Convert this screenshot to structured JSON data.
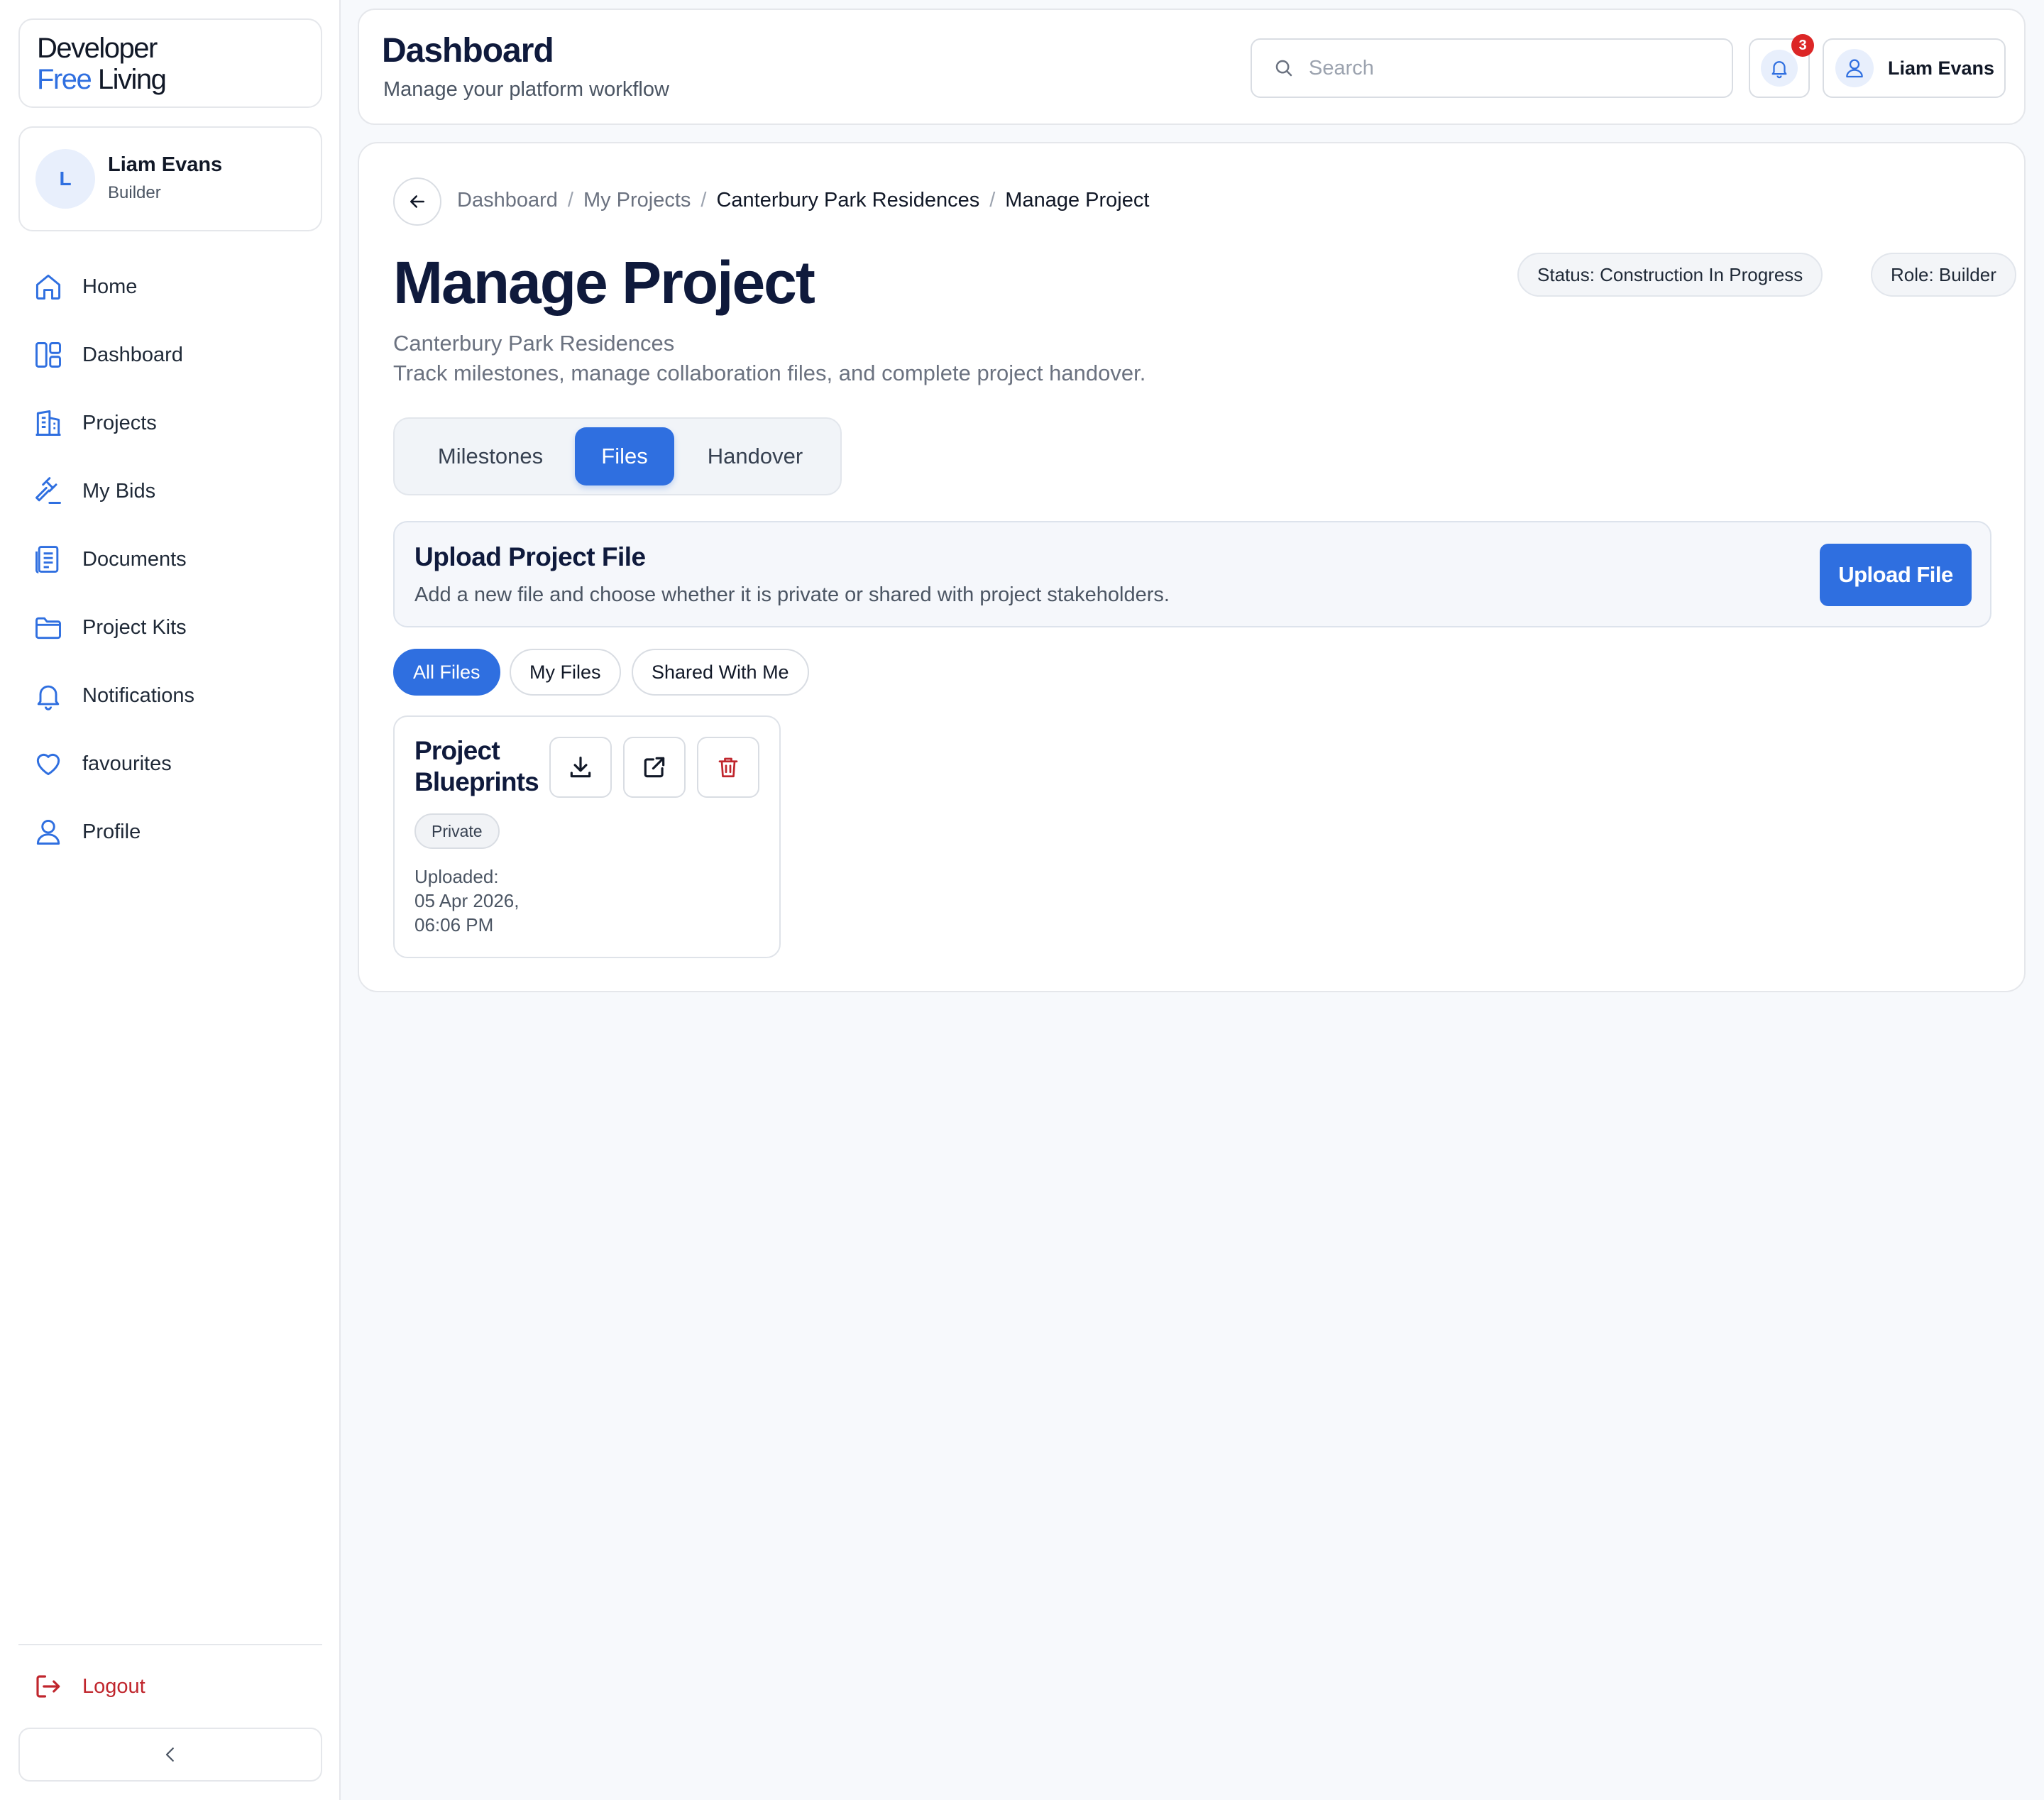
{
  "brand": {
    "line1": "Developer",
    "line2_accent": "Free",
    "line2_rest": " Living"
  },
  "user": {
    "initial": "L",
    "name": "Liam Evans",
    "role": "Builder"
  },
  "sidebar": {
    "items": [
      {
        "label": "Home",
        "icon": "home-icon"
      },
      {
        "label": "Dashboard",
        "icon": "dashboard-icon"
      },
      {
        "label": "Projects",
        "icon": "building-icon"
      },
      {
        "label": "My Bids",
        "icon": "gavel-icon"
      },
      {
        "label": "Documents",
        "icon": "document-icon"
      },
      {
        "label": "Project Kits",
        "icon": "folder-icon"
      },
      {
        "label": "Notifications",
        "icon": "bell-icon"
      },
      {
        "label": "favourites",
        "icon": "heart-icon"
      },
      {
        "label": "Profile",
        "icon": "user-icon"
      }
    ],
    "logout_label": "Logout",
    "collapse_icon": "chevron-left-icon"
  },
  "header": {
    "title": "Dashboard",
    "subtitle": "Manage your platform workflow",
    "search_placeholder": "Search",
    "notification_count": "3",
    "user_name": "Liam Evans"
  },
  "breadcrumb": [
    "Dashboard",
    "My Projects",
    "Canterbury Park Residences",
    "Manage Project"
  ],
  "page": {
    "title": "Manage Project",
    "status_pill": "Status: Construction In Progress",
    "role_pill": "Role: Builder",
    "project_name": "Canterbury Park Residences",
    "description": "Track milestones, manage collaboration files, and complete project handover."
  },
  "tabs": [
    {
      "label": "Milestones",
      "active": false
    },
    {
      "label": "Files",
      "active": true
    },
    {
      "label": "Handover",
      "active": false
    }
  ],
  "upload": {
    "title": "Upload Project File",
    "description": "Add a new file and choose whether it is private or shared with project stakeholders.",
    "button_label": "Upload File"
  },
  "filters": [
    {
      "label": "All Files",
      "active": true
    },
    {
      "label": "My Files",
      "active": false
    },
    {
      "label": "Shared With Me",
      "active": false
    }
  ],
  "files": [
    {
      "name": "Project Blueprints",
      "visibility": "Private",
      "uploaded_label": "Uploaded:",
      "uploaded_date": "05 Apr 2026,",
      "uploaded_time": "06:06 PM"
    }
  ],
  "colors": {
    "accent": "#2f6fe0",
    "danger": "#c0262d",
    "badge": "#dc2626",
    "title": "#0f1a3c"
  }
}
